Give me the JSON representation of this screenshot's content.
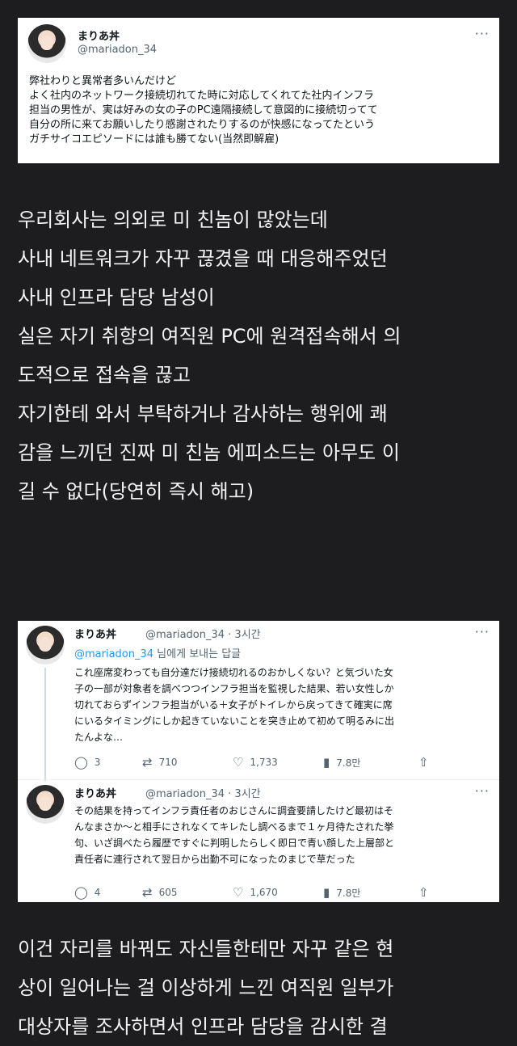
{
  "tweet": {
    "name": "まりあ丼",
    "handle": "@mariadon_34",
    "more": "···",
    "text": "弊社わりと異常者多いんだけど\nよく社内のネットワーク接続切れてた時に対応してくれてた社内インフラ\n担当の男性が、実は好みの女の子のPC遠隔接続して意図的に接続切ってて\n自分の所に来てお願いしたり感謝されたりするのが快感になってたという\nガチサイコエピソードには誰も勝てない(当然即解雇)"
  },
  "translation1": "우리회사는 의외로 미 친놈이 많았는데\n사내 네트워크가 자꾸 끊겼을 때 대응해주었던\n사내 인프라 담당 남성이\n실은 자기 취향의 여직원 PC에 원격접속해서 의\n도적으로 접속을 끊고\n자기한테 와서 부탁하거나 감사하는 행위에 쾌\n감을 느끼던 진짜 미 친놈 에피소드는 아무도 이\n길 수 없다(당연히 즉시 해고)",
  "replies": [
    {
      "name": "まりあ丼",
      "handle_time": "@mariadon_34 · 3시간",
      "replying_to": "@mariadon_34",
      "replying_suffix": " 님에게 보내는 답글",
      "text": "これ座席変わっても自分達だけ接続切れるのおかしくない？と気づいた女\n子の一部が対象者を調べつつインフラ担当を監視した結果、若い女性しか\n切れておらずインフラ担当がいる＋女子がトイレから戻ってきて確実に席\nにいるタイミングにしか起きていないことを突き止めて初めて明るみに出\nたんよな…",
      "replies": "3",
      "retweets": "710",
      "likes": "1,733",
      "views": "7.8만"
    },
    {
      "name": "まりあ丼",
      "handle_time": "@mariadon_34 · 3시간",
      "text": "その結果を持ってインフラ責任者のおじさんに調査要請したけど最初はそ\nんなまさか〜と相手にされなくてキレたし調べるまで１ヶ月待たされた挙\n句、いざ調べたら履歴ですぐに判明したらしく即日で青い顔した上層部と\n責任者に連行されて翌日から出勤不可になったのまじで草だった",
      "replies": "4",
      "retweets": "605",
      "likes": "1,670",
      "views": "7.8만"
    }
  ],
  "translation2": "이건 자리를 바꿔도 자신들한테만 자꾸 같은 현\n상이 일어나는 걸 이상하게 느낀 여직원 일부가\n대상자를 조사하면서 인프라 담당을 감시한 결",
  "icons": {
    "reply": "reply-icon",
    "retweet": "retweet-icon",
    "like": "heart-icon",
    "views": "views-chart-icon",
    "share": "share-icon"
  },
  "colors": {
    "background": "#1d1d1f",
    "link": "#1d9bf0",
    "muted": "#536471"
  }
}
